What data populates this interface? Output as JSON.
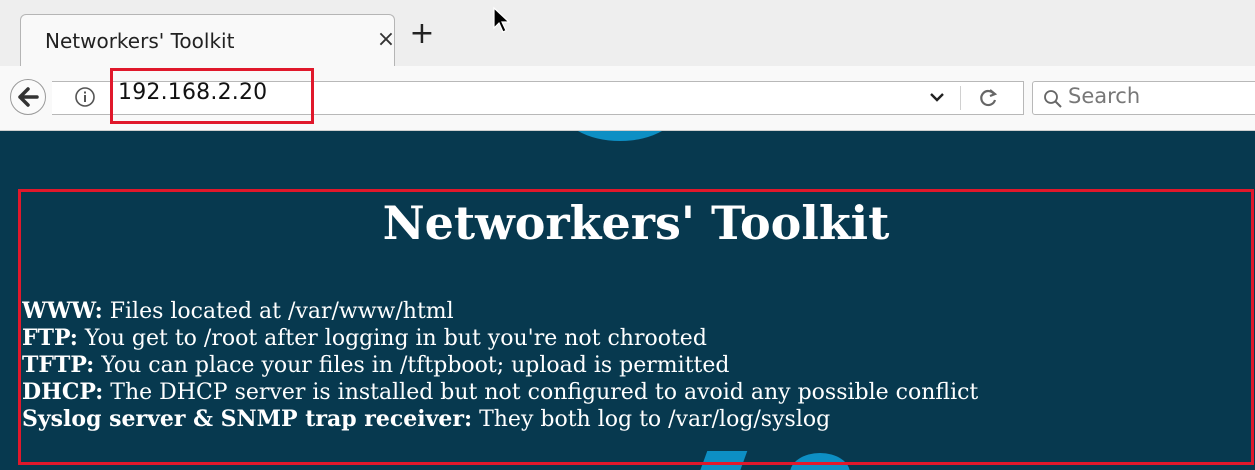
{
  "browser": {
    "tab": {
      "title": "Networkers' Toolkit",
      "close_label": "×"
    },
    "new_tab_label": "+",
    "url": "192.168.2.20",
    "search_placeholder": "Search"
  },
  "page": {
    "heading": "Networkers' Toolkit",
    "items": [
      {
        "key": "WWW:",
        "value": "Files located at /var/www/html"
      },
      {
        "key": "FTP:",
        "value": "You get to /root after logging in but you're not chrooted"
      },
      {
        "key": "TFTP:",
        "value": "You can place your files in /tftpboot; upload is permitted"
      },
      {
        "key": "DHCP:",
        "value": "The DHCP server is installed but not configured to avoid any possible conflict"
      },
      {
        "key": "Syslog server & SNMP trap receiver:",
        "value": "They both log to /var/log/syslog"
      }
    ]
  },
  "colors": {
    "page_background": "#07394f",
    "highlight_box": "#e0182b",
    "decoration": "#0d8fc4"
  }
}
